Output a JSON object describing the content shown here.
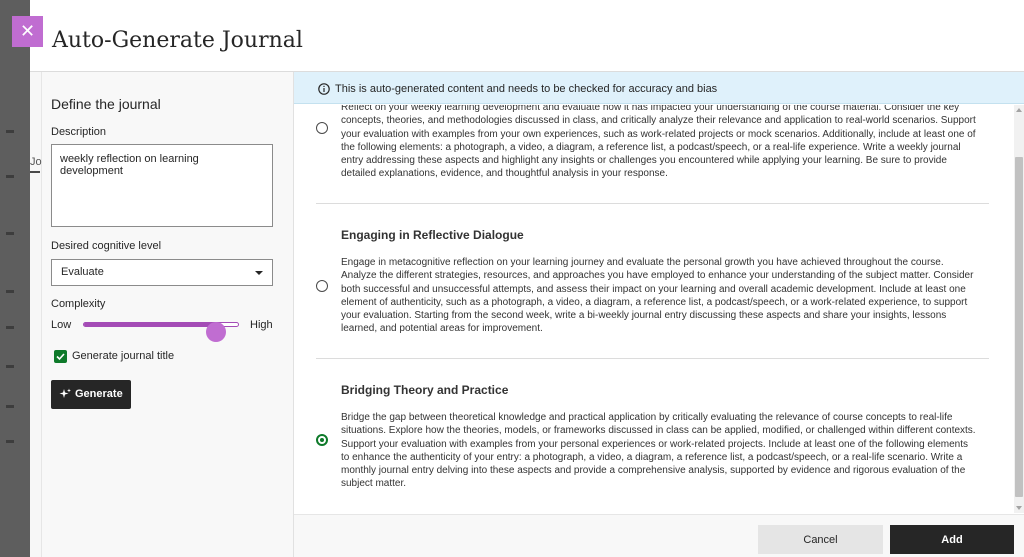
{
  "modal": {
    "title": "Auto-Generate Journal",
    "close_icon": "close-icon",
    "background_tab_label": "Jo"
  },
  "left_panel": {
    "heading": "Define the journal",
    "description_label": "Description",
    "description_value": "weekly reflection on learning development",
    "cognitive_level_label": "Desired cognitive level",
    "cognitive_level_value": "Evaluate",
    "complexity_label": "Complexity",
    "complexity_low": "Low",
    "complexity_high": "High",
    "complexity_level": 0.9,
    "generate_title_label": "Generate journal title",
    "generate_title_checked": true,
    "generate_button": "Generate",
    "generate_icon": "sparkle-icon"
  },
  "banner": {
    "icon": "info-icon",
    "text": "This is auto-generated content and needs to be checked for accuracy and bias"
  },
  "options": [
    {
      "title": "",
      "body": "Reflect on your weekly learning development and evaluate how it has impacted your understanding of the course material. Consider the key concepts, theories, and methodologies discussed in class, and critically analyze their relevance and application to real-world scenarios. Support your evaluation with examples from your own experiences, such as work-related projects or mock scenarios. Additionally, include at least one of the following elements: a photograph, a video, a diagram, a reference list, a podcast/speech, or a real-life experience. Write a weekly journal entry addressing these aspects and highlight any insights or challenges you encountered while applying your learning. Be sure to provide detailed explanations, evidence, and thoughtful analysis in your response.",
      "selected": false
    },
    {
      "title": "Engaging in Reflective Dialogue",
      "body": "Engage in metacognitive reflection on your learning journey and evaluate the personal growth you have achieved throughout the course. Analyze the different strategies, resources, and approaches you have employed to enhance your understanding of the subject matter. Consider both successful and unsuccessful attempts, and assess their impact on your learning and overall academic development. Include at least one element of authenticity, such as a photograph, a video, a diagram, a reference list, a podcast/speech, or a work-related experience, to support your evaluation. Starting from the second week, write a bi-weekly journal entry discussing these aspects and share your insights, lessons learned, and potential areas for improvement.",
      "selected": false
    },
    {
      "title": "Bridging Theory and Practice",
      "body": "Bridge the gap between theoretical knowledge and practical application by critically evaluating the relevance of course concepts to real-life situations. Explore how the theories, models, or frameworks discussed in class can be applied, modified, or challenged within different contexts. Support your evaluation with examples from your personal experiences or work-related projects. Include at least one of the following elements to enhance the authenticity of your entry: a photograph, a video, a diagram, a reference list, a podcast/speech, or a real-life scenario. Write a monthly journal entry delving into these aspects and provide a comprehensive analysis, supported by evidence and rigorous evaluation of the subject matter.",
      "selected": true
    }
  ],
  "footer": {
    "cancel": "Cancel",
    "add": "Add"
  },
  "colors": {
    "accent": "#c06dd1",
    "slider": "#a44cb6",
    "success": "#0e7a2a",
    "banner": "#dff1fb",
    "dark_button": "#262626"
  }
}
